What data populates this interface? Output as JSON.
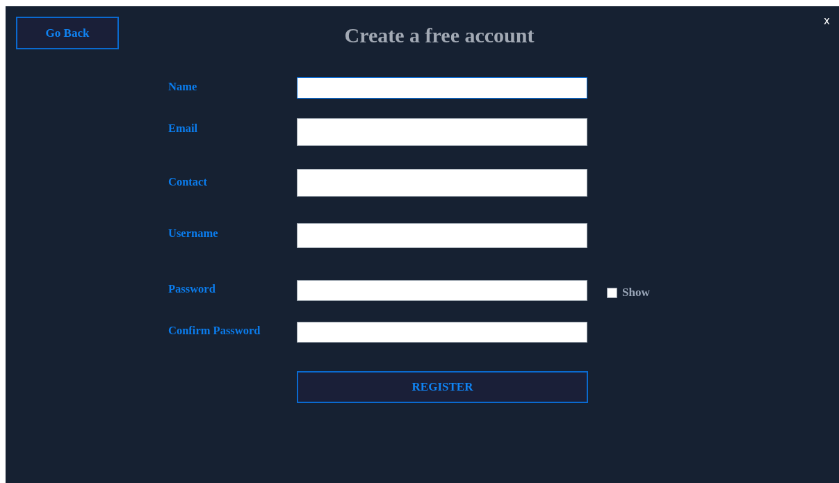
{
  "header": {
    "back_button": "Go Back",
    "title": "Create a free account",
    "close": "x"
  },
  "fields": [
    {
      "label": "Name",
      "focused": true
    },
    {
      "label": "Email",
      "focused": false
    },
    {
      "label": "Contact",
      "focused": false
    },
    {
      "label": "Username",
      "focused": false
    },
    {
      "label": "Password",
      "focused": false,
      "show_toggle": {
        "label": "Show",
        "checked": false
      }
    },
    {
      "label": "Confirm Password",
      "focused": false
    }
  ],
  "submit_button": "REGISTER"
}
